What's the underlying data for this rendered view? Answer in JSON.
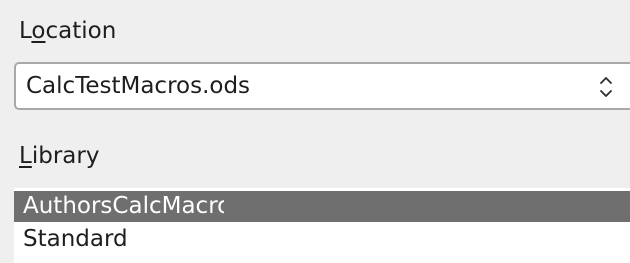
{
  "location": {
    "label_mnemonic": "L",
    "label_pre": "",
    "label_rest": "ocation",
    "label_underline_char": "o",
    "label_tail": "cation",
    "value": "CalcTestMacros.ods",
    "control_icon": "up-down-spinner-icon"
  },
  "library": {
    "label_mnemonic": "L",
    "label_rest": "ibrary",
    "items": [
      {
        "label": "AuthorsCalcMacros",
        "selected": true
      },
      {
        "label": "Standard",
        "selected": false
      }
    ]
  },
  "colors": {
    "selection": "#6f6f6f",
    "field_border": "#a8a8a8",
    "background": "#efefef"
  }
}
